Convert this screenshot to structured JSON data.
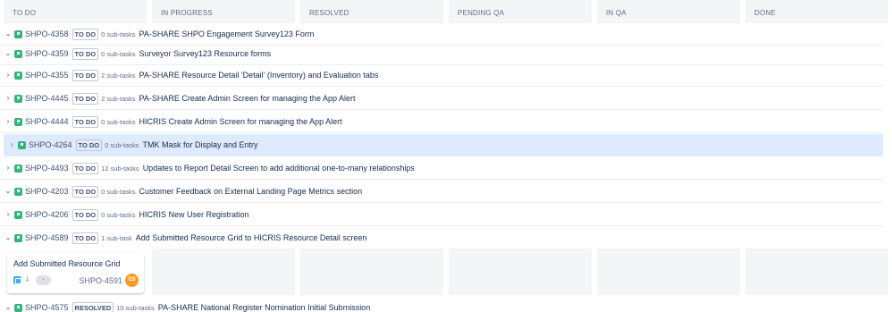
{
  "columns": [
    "TO DO",
    "IN PROGRESS",
    "RESOLVED",
    "PENDING QA",
    "IN QA",
    "DONE"
  ],
  "icons": {
    "expanded": "chevron-down-icon",
    "collapsed": "chevron-right-icon",
    "story": "story-icon",
    "subtask": "subtask-icon",
    "priority": "arrow-down-icon"
  },
  "colors": {
    "story": "#36b37e",
    "subtask": "#4bade8",
    "priority_low": "#00875a",
    "avatar": "#ff991f",
    "selected_row": "#deebff"
  },
  "lanes": [
    {
      "key": "SHPO-4358",
      "status": "TO DO",
      "subtasks": "0 sub-tasks",
      "summary": "PA-SHARE SHPO Engagement Survey123 Form",
      "chevron": "⌄"
    },
    {
      "key": "SHPO-4359",
      "status": "TO DO",
      "subtasks": "0 sub-tasks",
      "summary": "Surveyor Survey123 Resource forms",
      "chevron": "⌄"
    },
    {
      "key": "SHPO-4355",
      "status": "TO DO",
      "subtasks": "2 sub-tasks",
      "summary": "PA-SHARE Resource Detail 'Detail' (Inventory) and Evaluation tabs",
      "chevron": "›"
    },
    {
      "key": "SHPO-4445",
      "status": "TO DO",
      "subtasks": "2 sub-tasks",
      "summary": "PA-SHARE Create Admin Screen for managing the App Alert",
      "chevron": "›"
    },
    {
      "key": "SHPO-4444",
      "status": "TO DO",
      "subtasks": "0 sub-tasks",
      "summary": "HICRIS Create Admin Screen for managing the App Alert",
      "chevron": "›"
    },
    {
      "key": "SHPO-4264",
      "status": "TO DO",
      "subtasks": "0 sub-tasks",
      "summary": "TMK Mask for Display and Entry",
      "chevron": "›"
    },
    {
      "key": "SHPO-4493",
      "status": "TO DO",
      "subtasks": "12 sub-tasks",
      "summary": "Updates to Report Detail Screen to add additional one-to-many relationships",
      "chevron": "›"
    },
    {
      "key": "SHPO-4203",
      "status": "TO DO",
      "subtasks": "0 sub-tasks",
      "summary": "Customer Feedback on External Landing Page Metrics section",
      "chevron": "⌄"
    },
    {
      "key": "SHPO-4206",
      "status": "TO DO",
      "subtasks": "0 sub-tasks",
      "summary": "HICRIS New User Registration",
      "chevron": "›"
    },
    {
      "key": "SHPO-4589",
      "status": "TO DO",
      "subtasks": "1 sub-task",
      "summary": "Add Submitted Resource Grid to HICRIS Resource Detail screen",
      "chevron": "⌄"
    },
    {
      "key": "SHPO-4575",
      "status": "RESOLVED",
      "subtasks": "10 sub-tasks",
      "summary": "PA-SHARE National Register Nomination Initial Submission",
      "chevron": "⌄"
    }
  ],
  "card": {
    "title": "Add Submitted Resource Grid",
    "key": "SHPO-4591",
    "estimate": "-",
    "avatar": "ES",
    "priority_glyph": "↓"
  }
}
